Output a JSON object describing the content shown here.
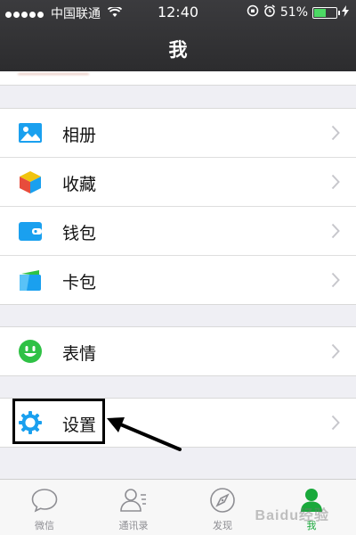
{
  "status_bar": {
    "carrier": "中国联通",
    "time": "12:40",
    "battery": "51%",
    "battery_level": 0.51
  },
  "header": {
    "title": "我"
  },
  "groups": [
    {
      "items": [
        {
          "label": "相册",
          "icon": "photo-album-icon"
        },
        {
          "label": "收藏",
          "icon": "favorites-cube-icon"
        },
        {
          "label": "钱包",
          "icon": "wallet-icon"
        },
        {
          "label": "卡包",
          "icon": "card-pack-icon"
        }
      ]
    },
    {
      "items": [
        {
          "label": "表情",
          "icon": "smiley-icon"
        }
      ]
    },
    {
      "items": [
        {
          "label": "设置",
          "icon": "gear-icon"
        }
      ]
    }
  ],
  "tabbar": {
    "tabs": [
      {
        "label": "微信",
        "icon": "chat-bubble-icon",
        "active": false
      },
      {
        "label": "通讯录",
        "icon": "contacts-icon",
        "active": false
      },
      {
        "label": "发现",
        "icon": "compass-icon",
        "active": false
      },
      {
        "label": "我",
        "icon": "person-icon",
        "active": true
      }
    ]
  },
  "watermark": "Baidu经验",
  "colors": {
    "header_bg": "#2c2c2e",
    "active_tab": "#19a93b",
    "icon_blue": "#1aa0ef",
    "icon_green": "#2fc145",
    "page_bg": "#efeff4"
  }
}
